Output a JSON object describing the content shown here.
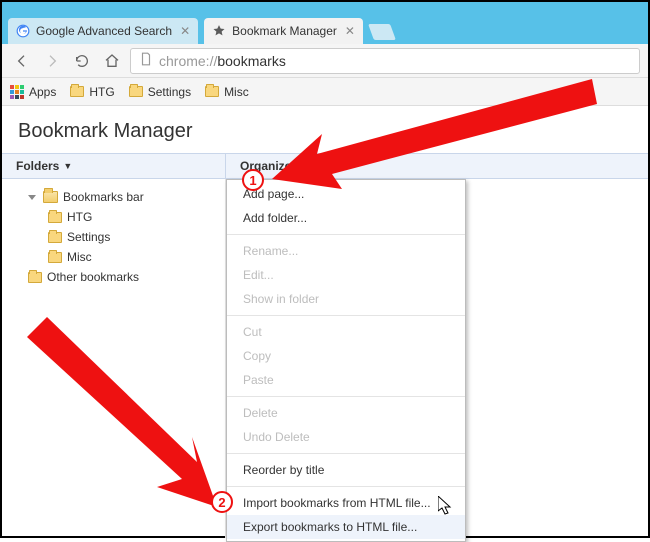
{
  "tabs": {
    "tab1": {
      "title": "Google Advanced Search"
    },
    "tab2": {
      "title": "Bookmark Manager"
    }
  },
  "omnibox": {
    "scheme": "chrome://",
    "path": "bookmarks"
  },
  "bookmarks_bar": {
    "apps_label": "Apps",
    "items": [
      "HTG",
      "Settings",
      "Misc"
    ]
  },
  "page": {
    "title": "Bookmark Manager"
  },
  "columns": {
    "folders": "Folders",
    "organize": "Organize"
  },
  "tree": {
    "root": "Bookmarks bar",
    "children": [
      "HTG",
      "Settings",
      "Misc"
    ],
    "other": "Other bookmarks"
  },
  "menu": {
    "add_page": "Add page...",
    "add_folder": "Add folder...",
    "rename": "Rename...",
    "edit": "Edit...",
    "show_in_folder": "Show in folder",
    "cut": "Cut",
    "copy": "Copy",
    "paste": "Paste",
    "delete": "Delete",
    "undo_delete": "Undo Delete",
    "reorder": "Reorder by title",
    "import_html": "Import bookmarks from HTML file...",
    "export_html": "Export bookmarks to HTML file..."
  },
  "callouts": {
    "one": "1",
    "two": "2"
  }
}
